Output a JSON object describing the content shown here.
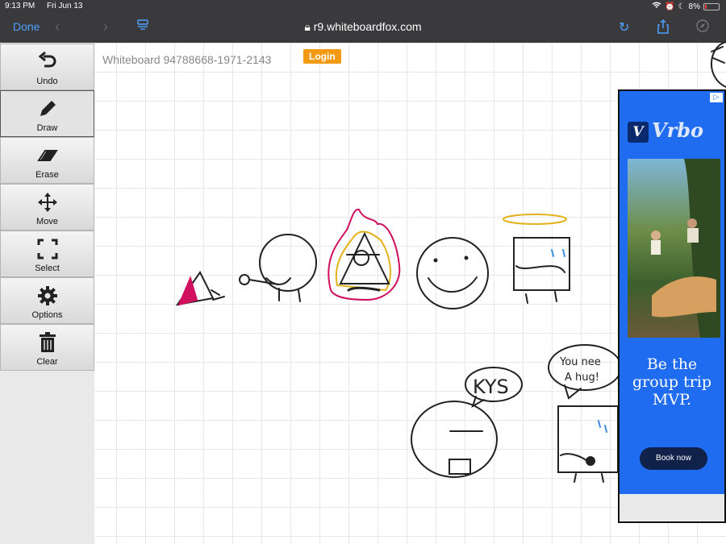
{
  "status": {
    "time": "9:13 PM",
    "date": "Fri Jun 13",
    "battery": "8%"
  },
  "browser": {
    "done_label": "Done",
    "url": "r9.whiteboardfox.com"
  },
  "tools": [
    {
      "label": "Undo",
      "icon": "undo-icon"
    },
    {
      "label": "Draw",
      "icon": "pencil-icon"
    },
    {
      "label": "Erase",
      "icon": "eraser-icon"
    },
    {
      "label": "Move",
      "icon": "move-icon"
    },
    {
      "label": "Select",
      "icon": "select-icon"
    },
    {
      "label": "Options",
      "icon": "gear-icon"
    },
    {
      "label": "Clear",
      "icon": "trash-icon"
    }
  ],
  "whiteboard": {
    "title": "Whiteboard 94788668-1971-2143",
    "login_label": "Login"
  },
  "drawing_text": {
    "bubble1": "KYS",
    "bubble2_line1": "You nee",
    "bubble2_line2": "A hug!"
  },
  "ad": {
    "brand": "Vrbo",
    "badge": "V",
    "headline_l1": "Be the",
    "headline_l2": "group trip",
    "headline_l3": "MVP.",
    "cta": "Book now"
  },
  "colors": {
    "accent": "#4ea0ff",
    "login": "#f39a12",
    "ad_blue": "#1f6cf0"
  }
}
